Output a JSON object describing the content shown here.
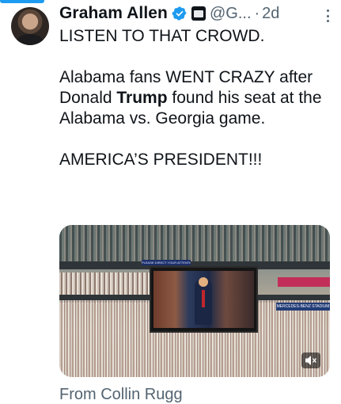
{
  "tweet": {
    "author_name": "Graham Allen",
    "handle": "@G...",
    "separator": "·",
    "time": "2d",
    "text": {
      "line1": "LISTEN TO THAT CROWD.",
      "para2_before": "Alabama fans WENT CRAZY after Donald ",
      "para2_bold": "Trump",
      "para2_after": " found his seat at the Alabama vs. Georgia game.",
      "para3": "AMERICA’S PRESIDENT!!!"
    },
    "media": {
      "jumbotron_banner": "PLEASE DIRECT YOUR ATTENTION",
      "right_sign": "MERCEDES-BENZ STADIUM"
    },
    "source_line": "From Collin Rugg"
  },
  "icons": {
    "verified": "verified-badge-icon",
    "affiliate": "affiliate-badge-icon",
    "more": "more-options-icon",
    "mute": "volume-muted-icon"
  },
  "colors": {
    "accent": "#1d9bf0",
    "text": "#0f1419",
    "secondary": "#536471"
  }
}
